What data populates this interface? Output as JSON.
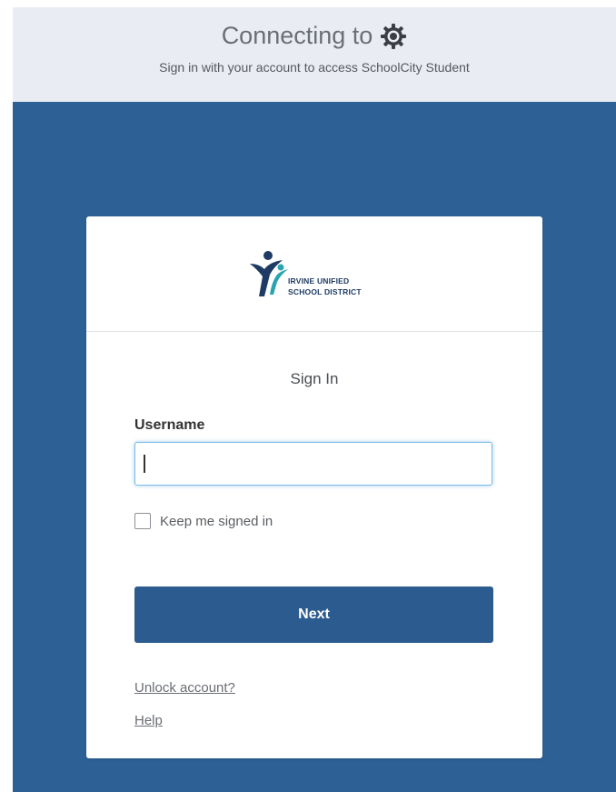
{
  "header": {
    "title": "Connecting to",
    "subtitle": "Sign in with your account to access SchoolCity Student",
    "icon": "gear-icon"
  },
  "logo": {
    "line1": "IRVINE UNIFIED",
    "line2": "SCHOOL DISTRICT",
    "colors": {
      "navy": "#1d3b63",
      "teal": "#28a4b0"
    }
  },
  "form": {
    "title": "Sign In",
    "username_label": "Username",
    "username_value": "",
    "remember_label": "Keep me signed in",
    "remember_checked": false,
    "next_label": "Next"
  },
  "links": {
    "unlock": "Unlock account?",
    "help": "Help"
  },
  "colors": {
    "backdrop": "#2d6195",
    "header_bg": "#e9edf3",
    "button": "#2c5b8f",
    "focus_border": "#7dbbe6"
  }
}
